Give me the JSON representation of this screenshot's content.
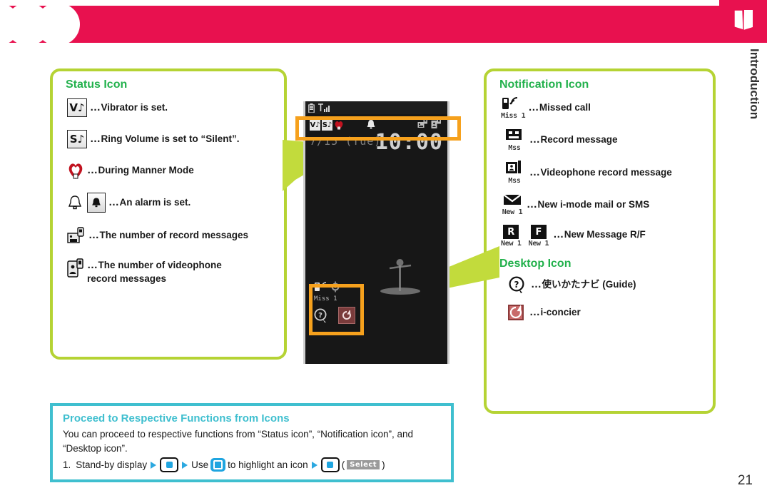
{
  "page": {
    "number": "21",
    "side_tab_label": "Introduction",
    "side_tab_icon": "book-icon",
    "header_color": "#E8114F",
    "panel_border_color": "#B5D334",
    "panel_heading_color": "#22B14C",
    "note_accent_color": "#3FBFCF",
    "highlight_color": "#F6A11D",
    "arrow_color": "#C2DB3C"
  },
  "status_panel": {
    "title": "Status Icon",
    "rows": [
      {
        "icons": [
          "vibrator-icon"
        ],
        "glyphs": [
          "V♪"
        ],
        "text": "Vibrator is set."
      },
      {
        "icons": [
          "silent-icon"
        ],
        "glyphs": [
          "S♪"
        ],
        "text": "Ring Volume is set to “Silent”."
      },
      {
        "icons": [
          "manner-mode-heart-icon"
        ],
        "glyphs": [
          "♥"
        ],
        "text": "During Manner Mode"
      },
      {
        "icons": [
          "alarm-bell-outline-icon",
          "alarm-bell-filled-icon"
        ],
        "glyphs": [
          "♤",
          "♠"
        ],
        "text": "An alarm is set."
      },
      {
        "icons": [
          "record-message-count-icon"
        ],
        "glyphs": [
          ""
        ],
        "text": "The number of record messages"
      },
      {
        "icons": [
          "videophone-record-count-icon"
        ],
        "glyphs": [
          ""
        ],
        "text": "The number of videophone record messages"
      }
    ]
  },
  "notification_panel": {
    "title": "Notification Icon",
    "rows": [
      {
        "icons": [
          "missed-call-icon"
        ],
        "sublabels": [
          "Miss 1"
        ],
        "text": "Missed call"
      },
      {
        "icons": [
          "record-message-icon"
        ],
        "sublabels": [
          "Mss"
        ],
        "text": "Record message"
      },
      {
        "icons": [
          "videophone-record-message-icon"
        ],
        "sublabels": [
          "Mss"
        ],
        "text": "Videophone record message"
      },
      {
        "icons": [
          "new-mail-icon"
        ],
        "sublabels": [
          "New 1"
        ],
        "text": "New i-mode mail or SMS"
      },
      {
        "icons": [
          "message-r-icon",
          "message-f-icon"
        ],
        "glyphs": [
          "R",
          "F"
        ],
        "sublabels": [
          "New 1",
          "New 1"
        ],
        "text": "New Message R/F"
      }
    ],
    "desktop_title": "Desktop Icon",
    "desktop_rows": [
      {
        "icons": [
          "guide-navi-icon"
        ],
        "text": "使いかたナビ (Guide)"
      },
      {
        "icons": [
          "i-concier-icon"
        ],
        "text": "i-concier"
      }
    ]
  },
  "phone_screen": {
    "date": "7/15 (Tue)",
    "time": "10:00",
    "topbar_icons": [
      "battery-icon",
      "signal-strength-icon"
    ],
    "statusbar_icons": [
      "vibrator-icon",
      "silent-icon",
      "manner-mode-heart-icon",
      "alarm-bell-icon",
      "record-message-count-icon",
      "videophone-record-count-icon"
    ],
    "statusbar_glyphs": [
      "V♪",
      "S♪",
      "♥",
      "♠",
      "",
      ""
    ],
    "desktop_missed_sub": "Miss 1",
    "desktop_icons": [
      "missed-call-icon",
      "guide-navi-icon",
      "i-concier-icon"
    ]
  },
  "note_box": {
    "title": "Proceed to Respective Functions from Icons",
    "body": "You can proceed to respective functions from “Status icon”, “Notification icon”, and “Desktop icon”.",
    "step_number": "1.",
    "step_part1": "Stand-by display",
    "step_part2": "Use",
    "step_part3": "to highlight an icon",
    "select_label": "Select"
  }
}
